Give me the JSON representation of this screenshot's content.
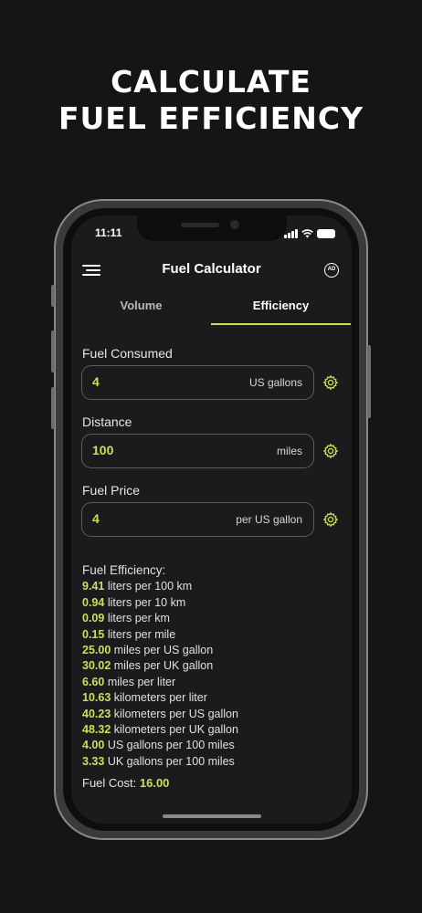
{
  "headline": {
    "line1": "CALCULATE",
    "line2": "FUEL EFFICIENCY"
  },
  "status_bar": {
    "time": "11:11"
  },
  "app": {
    "title": "Fuel Calculator",
    "ad_icon_text": "AD",
    "tabs": [
      {
        "label": "Volume",
        "active": false
      },
      {
        "label": "Efficiency",
        "active": true
      }
    ]
  },
  "form": {
    "fuel_consumed": {
      "label": "Fuel Consumed",
      "value": "4",
      "unit": "US gallons"
    },
    "distance": {
      "label": "Distance",
      "value": "100",
      "unit": "miles"
    },
    "fuel_price": {
      "label": "Fuel Price",
      "value": "4",
      "unit": "per US gallon"
    }
  },
  "results": {
    "title": "Fuel Efficiency:",
    "rows": [
      {
        "value": "9.41",
        "unit": "liters per 100 km"
      },
      {
        "value": "0.94",
        "unit": "liters per 10 km"
      },
      {
        "value": "0.09",
        "unit": "liters per km"
      },
      {
        "value": "0.15",
        "unit": "liters per mile"
      },
      {
        "value": "25.00",
        "unit": "miles per US gallon"
      },
      {
        "value": "30.02",
        "unit": "miles per UK gallon"
      },
      {
        "value": "6.60",
        "unit": "miles per liter"
      },
      {
        "value": "10.63",
        "unit": "kilometers per liter"
      },
      {
        "value": "40.23",
        "unit": "kilometers per US gallon"
      },
      {
        "value": "48.32",
        "unit": "kilometers per UK gallon"
      },
      {
        "value": "4.00",
        "unit": "US gallons per 100 miles"
      },
      {
        "value": "3.33",
        "unit": "UK gallons per 100 miles"
      }
    ],
    "cost_label": "Fuel Cost:",
    "cost_value": "16.00"
  },
  "colors": {
    "accent": "#c8e05a",
    "background": "#161516",
    "screen": "#1b1b1d"
  }
}
